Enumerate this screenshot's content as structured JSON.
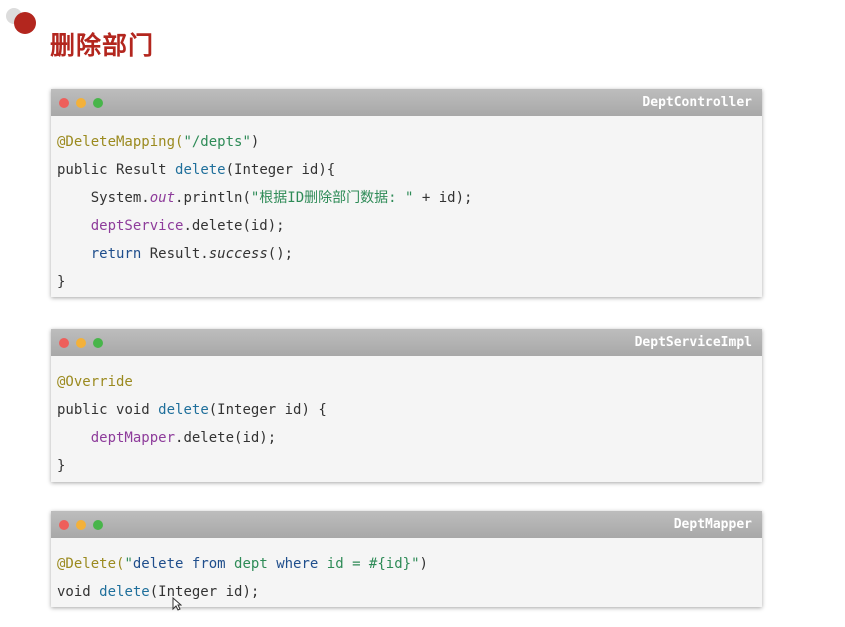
{
  "page": {
    "title": "删除部门"
  },
  "colors": {
    "accent": "#b3261e",
    "dot_red": "#ee5f5b",
    "dot_yellow": "#f3b13a",
    "dot_green": "#48b54a"
  },
  "windows": [
    {
      "title": "DeptController",
      "lines": [
        [
          {
            "t": "@DeleteMapping(",
            "c": "ann"
          },
          {
            "t": "\"/depts\"",
            "c": "str"
          },
          {
            "t": ")",
            "c": ""
          }
        ],
        [
          {
            "t": "public ",
            "c": ""
          },
          {
            "t": "Result ",
            "c": ""
          },
          {
            "t": "delete",
            "c": "fn"
          },
          {
            "t": "(Integer id){",
            "c": ""
          }
        ],
        [
          {
            "t": "    System.",
            "c": ""
          },
          {
            "t": "out",
            "c": "itfld"
          },
          {
            "t": ".println(",
            "c": ""
          },
          {
            "t": "\"根据ID删除部门数据: \"",
            "c": "str"
          },
          {
            "t": " + id);",
            "c": ""
          }
        ],
        [
          {
            "t": "    ",
            "c": ""
          },
          {
            "t": "deptService",
            "c": "fld"
          },
          {
            "t": ".delete(id);",
            "c": ""
          }
        ],
        [
          {
            "t": "    ",
            "c": ""
          },
          {
            "t": "return ",
            "c": "kw"
          },
          {
            "t": "Result.",
            "c": ""
          },
          {
            "t": "success",
            "c": "it"
          },
          {
            "t": "();",
            "c": ""
          }
        ],
        [
          {
            "t": "}",
            "c": ""
          }
        ]
      ]
    },
    {
      "title": "DeptServiceImpl",
      "lines": [
        [
          {
            "t": "@Override",
            "c": "ann"
          }
        ],
        [
          {
            "t": "public ",
            "c": ""
          },
          {
            "t": "void ",
            "c": ""
          },
          {
            "t": "delete",
            "c": "fn"
          },
          {
            "t": "(Integer id) {",
            "c": ""
          }
        ],
        [
          {
            "t": "    ",
            "c": ""
          },
          {
            "t": "deptMapper",
            "c": "fld"
          },
          {
            "t": ".delete(id);",
            "c": ""
          }
        ],
        [
          {
            "t": "}",
            "c": ""
          }
        ]
      ]
    },
    {
      "title": "DeptMapper",
      "lines": [
        [
          {
            "t": "@Delete(",
            "c": "ann"
          },
          {
            "t": "\"",
            "c": "str"
          },
          {
            "t": "delete ",
            "c": "kw"
          },
          {
            "t": "from ",
            "c": "kw"
          },
          {
            "t": "dept ",
            "c": "str"
          },
          {
            "t": "where ",
            "c": "kw"
          },
          {
            "t": "id ",
            "c": "str"
          },
          {
            "t": "= #{id}\"",
            "c": "str"
          },
          {
            "t": ")",
            "c": ""
          }
        ],
        [
          {
            "t": "void ",
            "c": ""
          },
          {
            "t": "delete",
            "c": "fn"
          },
          {
            "t": "(Integer id);",
            "c": ""
          }
        ]
      ]
    }
  ]
}
